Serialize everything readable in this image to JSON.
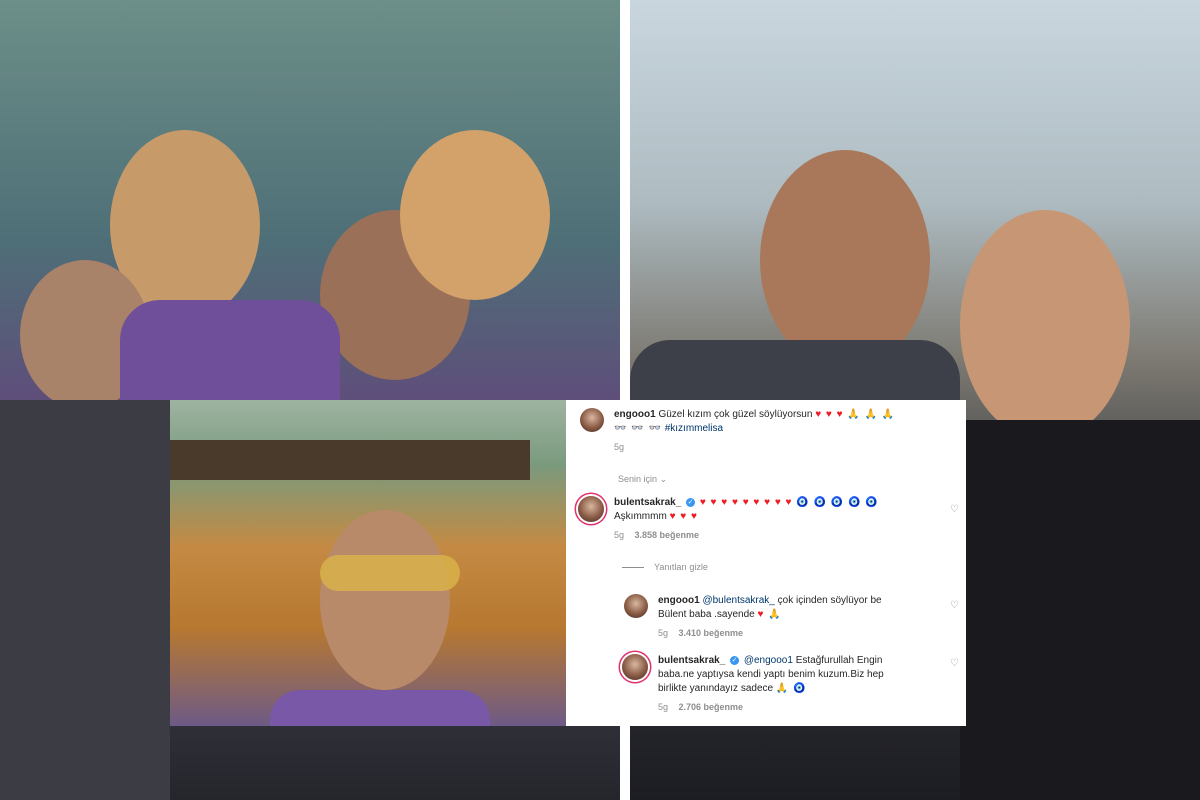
{
  "comments": [
    {
      "user": "engooo1",
      "text": "Güzel kızım çok güzel söylüyorsun",
      "emoji_line1": "♥ ♥ ♥ 🙏 🙏 🙏",
      "emoji_line2": "👓 👓 👓",
      "hashtag": "#kızımmelisa",
      "time": "5g"
    },
    {
      "user": "bulentsakrak_",
      "emoji_row": "♥ ♥ ♥ ♥ ♥ ♥ ♥ ♥ ♥ 🧿 🧿 🧿 🧿 🧿",
      "text": "Aşkımmmm",
      "emoji_tail": "♥ ♥ ♥",
      "time": "5g",
      "likes": "3.858 beğenme"
    },
    {
      "user": "engooo1",
      "mention": "@bulentsakrak_",
      "text_part1": "çok içinden söylüyor be",
      "text_part2": "Bülent baba .sayende",
      "emoji_tail": "♥ 🙏",
      "time": "5g",
      "likes": "3.410 beğenme"
    },
    {
      "user": "bulentsakrak_",
      "mention": "@engooo1",
      "text_part1": "Estağfurullah Engin",
      "text_part2": "baba.ne yaptıysa kendi yaptı benim kuzum.Biz hep",
      "text_part3": "birlikte yanındayız sadece",
      "emoji_tail": "🙏 🧿",
      "time": "5g",
      "likes": "2.706 beğenme"
    }
  ],
  "labels": {
    "for_you": "Senin için",
    "hide_replies": "Yanıtları gizle"
  },
  "icons": {
    "like": "heart-outline-icon",
    "dropdown": "chevron-down-icon",
    "verified": "verified-badge-icon"
  },
  "colors": {
    "mention": "#00376b",
    "verified": "#3897f0",
    "meta": "#8e8e8e",
    "heart": "#ed1c24"
  }
}
